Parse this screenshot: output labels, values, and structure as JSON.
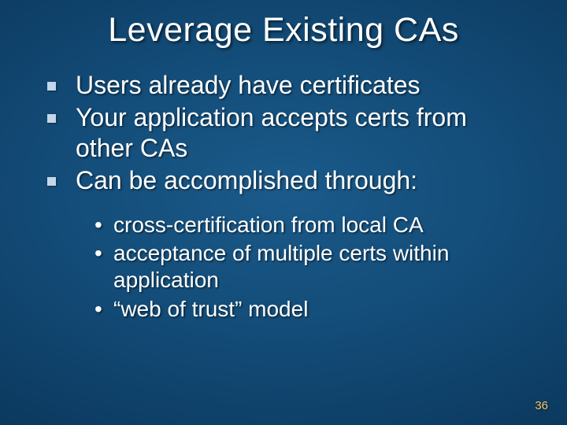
{
  "title": "Leverage Existing CAs",
  "bullets": {
    "b0": "Users already have certificates",
    "b1": "Your application accepts certs from other CAs",
    "b2": "Can be accomplished through:"
  },
  "sub": {
    "s0": "cross-certification from local CA",
    "s1": "acceptance of multiple certs within application",
    "s2": "“web of trust” model"
  },
  "page_number": "36"
}
